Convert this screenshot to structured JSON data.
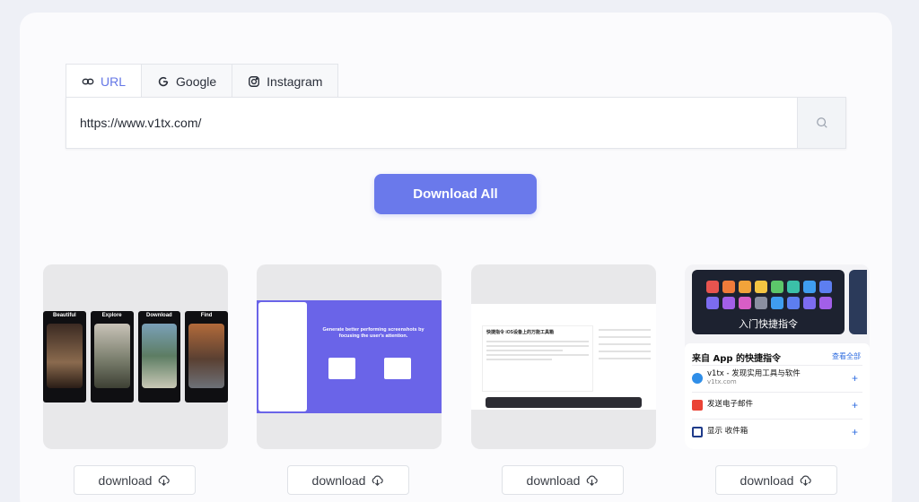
{
  "tabs": [
    {
      "label": "URL",
      "icon": "link-icon",
      "active": true
    },
    {
      "label": "Google",
      "icon": "google-icon",
      "active": false
    },
    {
      "label": "Instagram",
      "icon": "instagram-icon",
      "active": false
    }
  ],
  "url_input": {
    "value": "https://www.v1tx.com/",
    "placeholder": ""
  },
  "download_all_label": "Download All",
  "results": [
    {
      "type": "phone-screens",
      "screens": [
        "Beautiful",
        "Explore",
        "Download",
        "Find"
      ],
      "download_label": "download"
    },
    {
      "type": "landing-page",
      "headline": "Generate better performing screenshots by focusing the user's attention.",
      "download_label": "download"
    },
    {
      "type": "article-page",
      "heading": "快捷指令 iOS设备上的万能工具箱",
      "download_label": "download"
    },
    {
      "type": "shortcuts-list",
      "banner_title": "入门快捷指令",
      "list_header": "来自 App 的快捷指令",
      "see_all": "查看全部",
      "rows": [
        {
          "title": "v1tx - 发现实用工具与软件",
          "subtitle": "v1tx.com"
        },
        {
          "title": "发送电子邮件",
          "subtitle": ""
        },
        {
          "title": "显示 收件箱",
          "subtitle": ""
        }
      ],
      "download_label": "download"
    }
  ],
  "colors": {
    "accent": "#6a79eb",
    "active_tab_text": "#6476e6",
    "background": "#eef0f6"
  }
}
